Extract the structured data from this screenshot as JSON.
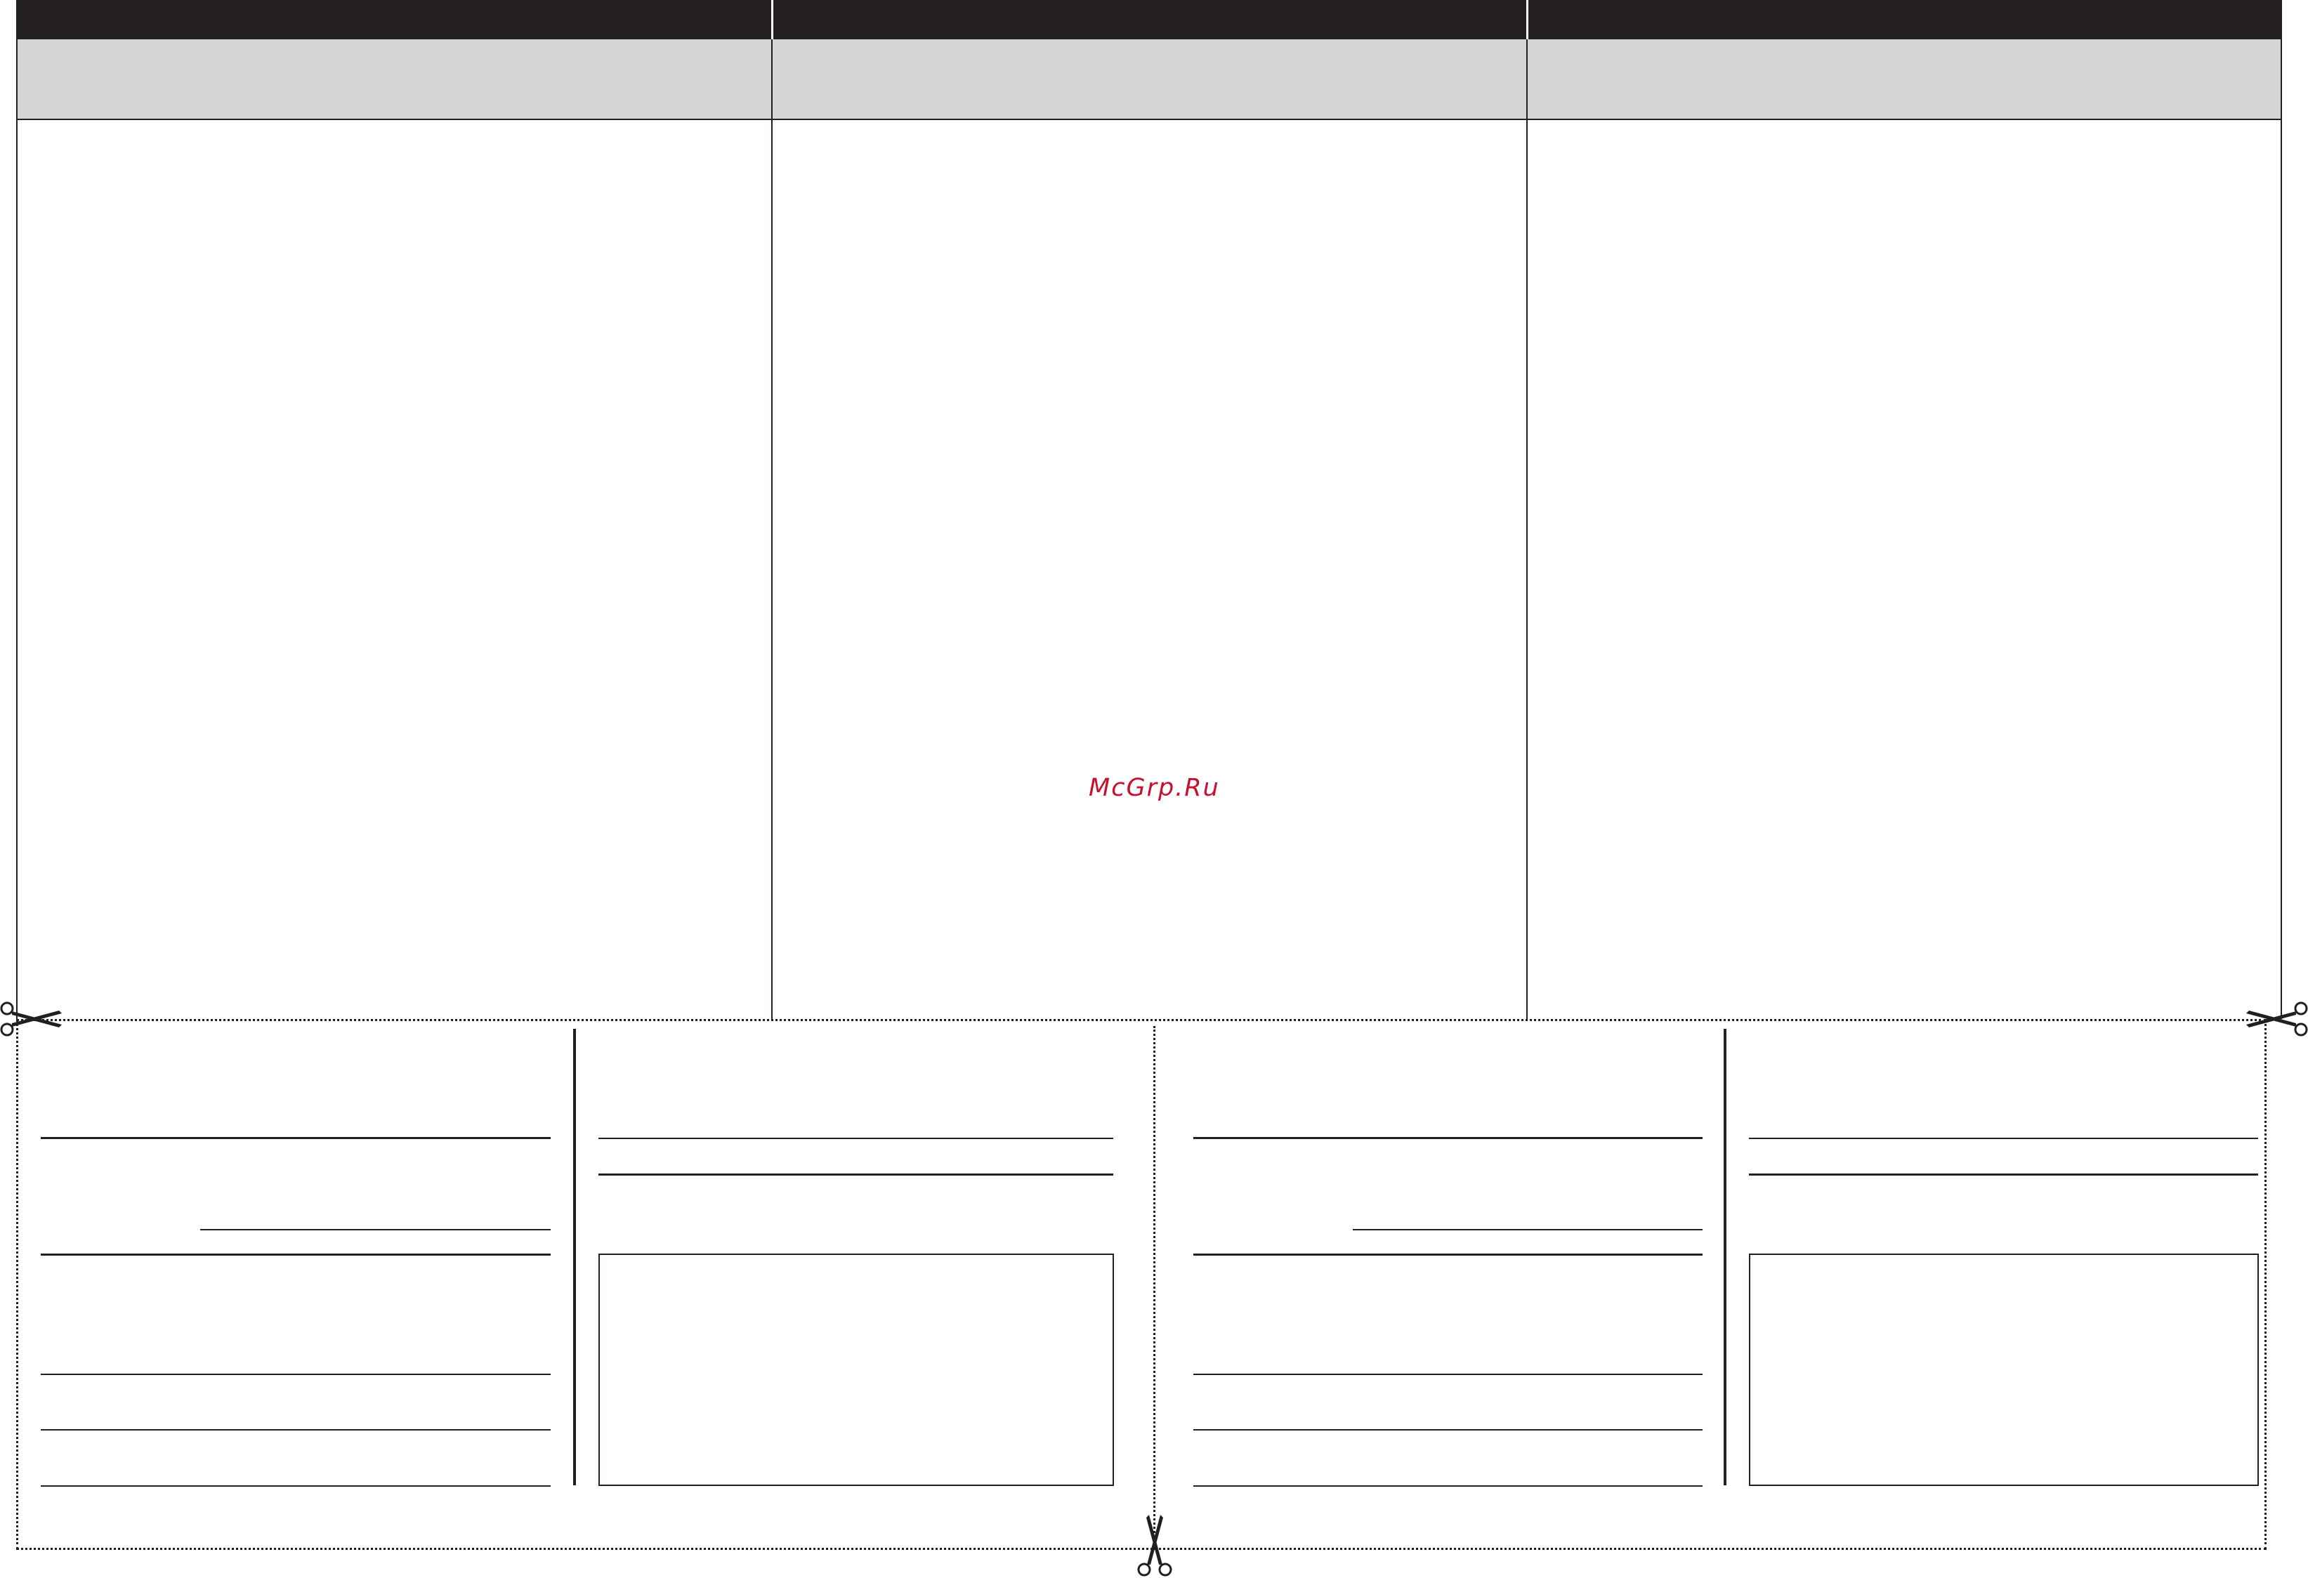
{
  "watermark": {
    "text": "McGrp.Ru",
    "color": "#c8102e"
  },
  "colors": {
    "header_bar": "#231f20",
    "header_band": "#d4d4d6",
    "ink": "#231f20"
  },
  "icons": {
    "left_cut": "scissors-icon",
    "right_cut": "scissors-icon",
    "bottom_cut": "scissors-icon"
  }
}
